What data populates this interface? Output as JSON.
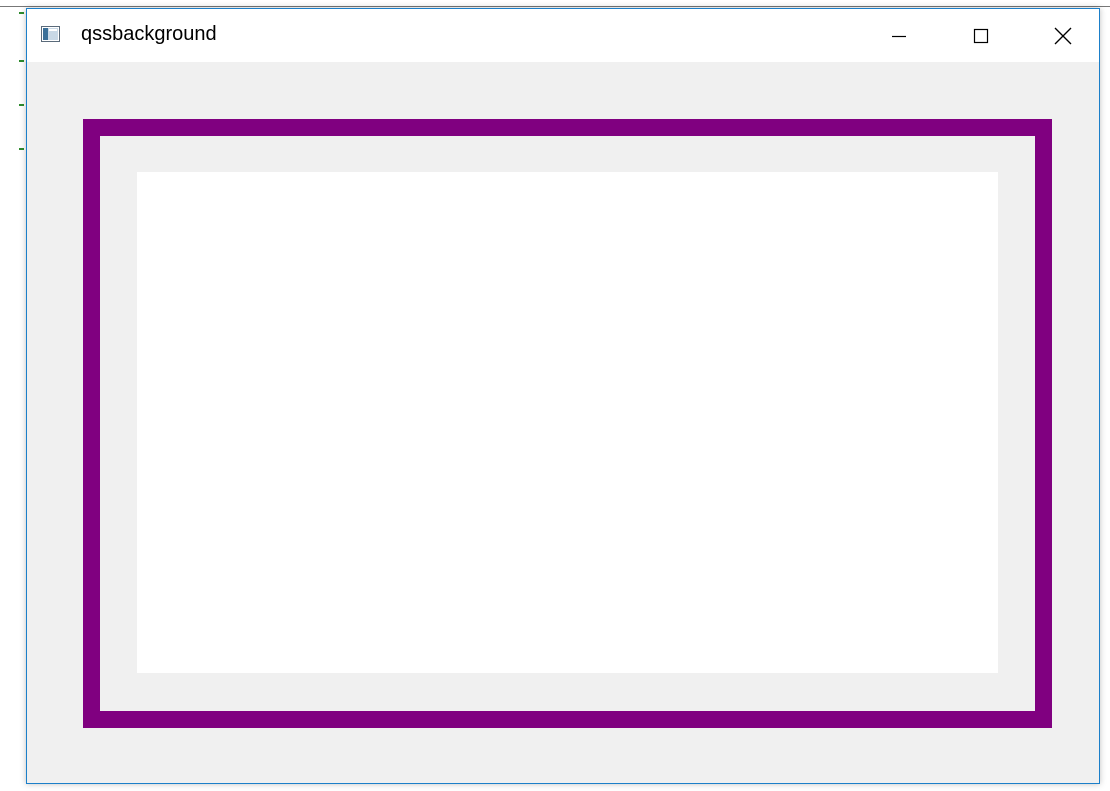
{
  "window": {
    "title": "qssbackground",
    "controls": {
      "minimize_icon": "minimize-icon",
      "maximize_icon": "maximize-icon",
      "close_icon": "close-icon"
    }
  },
  "content": {
    "frame_color": "#800080",
    "frame_fill": "#f0f0f0",
    "panel_color": "#ffffff"
  },
  "colors": {
    "window_border": "#1b7fc9",
    "client_background": "#f0f0f0"
  }
}
